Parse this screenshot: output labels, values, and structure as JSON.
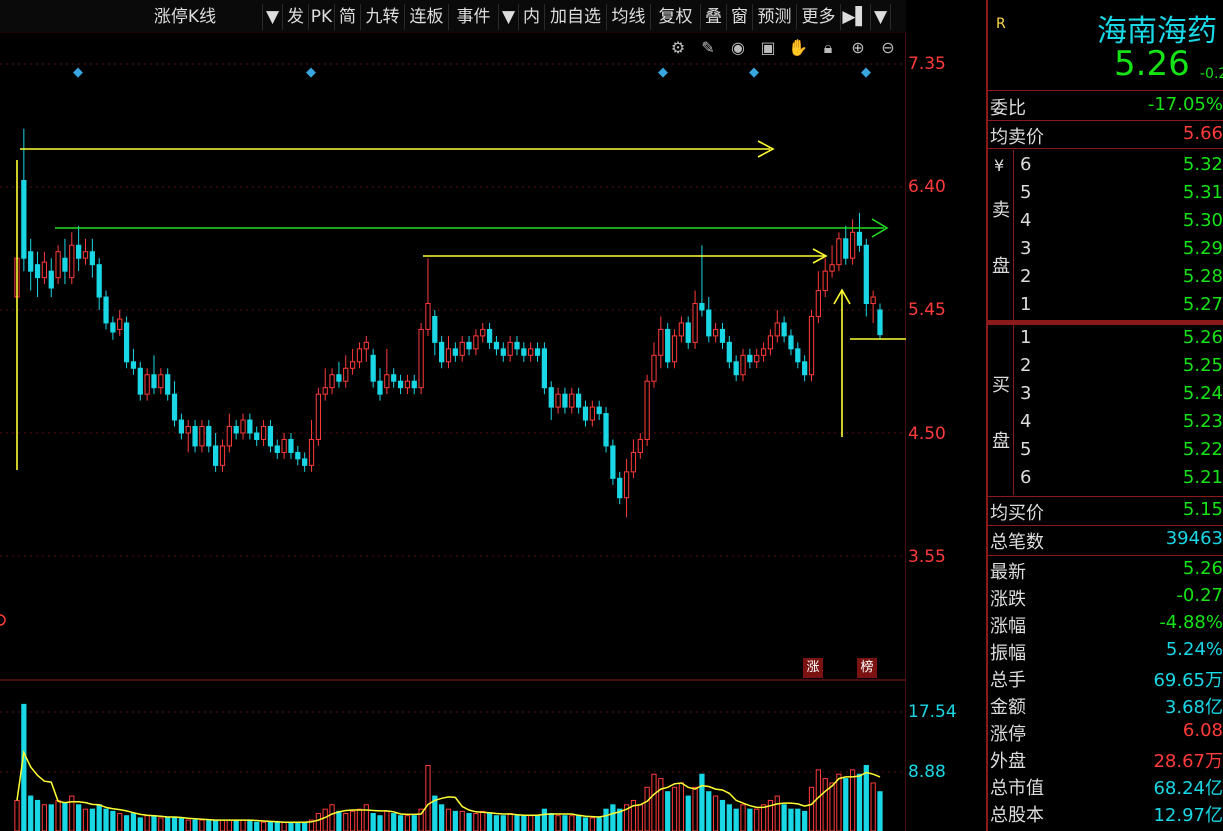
{
  "toolbar": {
    "items": [
      "涨停K线",
      "▼",
      "发",
      "PK",
      "简",
      "九转",
      "连板",
      "事件",
      "▼",
      "内",
      "加自选",
      "均线",
      "复权",
      "叠",
      "窗",
      "预测",
      "更多",
      "▶▌",
      "▼"
    ]
  },
  "chart_tools": [
    "gear-icon",
    "pen-icon",
    "eye-icon",
    "trash-icon",
    "hand-icon",
    "lock-icon",
    "zoom-in-icon",
    "zoom-out-icon"
  ],
  "chart_data": {
    "type": "candlestick",
    "price_axis": {
      "ticks": [
        "7.35",
        "6.40",
        "5.45",
        "4.50",
        "3.55"
      ],
      "ylim": [
        3.0,
        7.72
      ]
    },
    "volume_axis": {
      "ticks": [
        "17.54",
        "8.88"
      ]
    },
    "bottom_tags": [
      "涨",
      "榜"
    ],
    "candles": [
      [
        5.55,
        5.85,
        6.3,
        4.25
      ],
      [
        6.45,
        5.85,
        6.85,
        5.75
      ],
      [
        5.9,
        5.75,
        6.0,
        5.6
      ],
      [
        5.8,
        5.7,
        5.9,
        5.55
      ],
      [
        5.7,
        5.82,
        5.9,
        5.65
      ],
      [
        5.75,
        5.62,
        5.85,
        5.55
      ],
      [
        5.7,
        5.9,
        5.95,
        5.65
      ],
      [
        5.85,
        5.75,
        6.0,
        5.65
      ],
      [
        5.7,
        5.95,
        6.05,
        5.65
      ],
      [
        5.95,
        5.85,
        6.1,
        5.75
      ],
      [
        5.85,
        5.9,
        6.0,
        5.8
      ],
      [
        5.9,
        5.8,
        6.0,
        5.7
      ],
      [
        5.8,
        5.55,
        5.85,
        5.45
      ],
      [
        5.55,
        5.35,
        5.6,
        5.3
      ],
      [
        5.35,
        5.28,
        5.4,
        5.22
      ],
      [
        5.3,
        5.38,
        5.45,
        5.25
      ],
      [
        5.35,
        5.05,
        5.4,
        5.0
      ],
      [
        5.05,
        5.0,
        5.15,
        4.95
      ],
      [
        5.0,
        4.8,
        5.05,
        4.75
      ],
      [
        4.8,
        4.95,
        5.0,
        4.75
      ],
      [
        4.95,
        4.85,
        5.1,
        4.8
      ],
      [
        4.85,
        4.95,
        5.0,
        4.8
      ],
      [
        4.95,
        4.8,
        5.0,
        4.75
      ],
      [
        4.8,
        4.6,
        4.9,
        4.55
      ],
      [
        4.6,
        4.5,
        4.65,
        4.45
      ],
      [
        4.5,
        4.55,
        4.6,
        4.35
      ],
      [
        4.55,
        4.4,
        4.6,
        4.35
      ],
      [
        4.4,
        4.55,
        4.6,
        4.35
      ],
      [
        4.55,
        4.4,
        4.6,
        4.35
      ],
      [
        4.4,
        4.25,
        4.5,
        4.2
      ],
      [
        4.25,
        4.4,
        4.45,
        4.2
      ],
      [
        4.4,
        4.55,
        4.65,
        4.35
      ],
      [
        4.55,
        4.5,
        4.6,
        4.45
      ],
      [
        4.5,
        4.6,
        4.65,
        4.45
      ],
      [
        4.6,
        4.5,
        4.65,
        4.45
      ],
      [
        4.5,
        4.45,
        4.55,
        4.4
      ],
      [
        4.45,
        4.55,
        4.6,
        4.4
      ],
      [
        4.55,
        4.4,
        4.6,
        4.35
      ],
      [
        4.4,
        4.35,
        4.45,
        4.3
      ],
      [
        4.35,
        4.45,
        4.5,
        4.3
      ],
      [
        4.45,
        4.35,
        4.5,
        4.3
      ],
      [
        4.35,
        4.3,
        4.4,
        4.25
      ],
      [
        4.3,
        4.25,
        4.35,
        4.2
      ],
      [
        4.25,
        4.45,
        4.6,
        4.2
      ],
      [
        4.45,
        4.8,
        4.85,
        4.4
      ],
      [
        4.8,
        4.85,
        5.0,
        4.75
      ],
      [
        4.85,
        4.95,
        5.0,
        4.8
      ],
      [
        4.95,
        4.9,
        5.05,
        4.85
      ],
      [
        4.9,
        5.0,
        5.1,
        4.85
      ],
      [
        5.0,
        5.05,
        5.15,
        4.95
      ],
      [
        5.05,
        5.15,
        5.2,
        5.0
      ],
      [
        5.15,
        5.2,
        5.25,
        5.05
      ],
      [
        5.1,
        4.9,
        5.15,
        4.85
      ],
      [
        4.9,
        4.8,
        5.0,
        4.75
      ],
      [
        4.85,
        4.95,
        5.15,
        4.8
      ],
      [
        4.95,
        4.9,
        5.0,
        4.85
      ],
      [
        4.9,
        4.85,
        4.95,
        4.8
      ],
      [
        4.85,
        4.9,
        4.95,
        4.8
      ],
      [
        4.9,
        4.85,
        4.95,
        4.8
      ],
      [
        4.85,
        5.3,
        5.35,
        4.8
      ],
      [
        5.3,
        5.5,
        5.85,
        5.25
      ],
      [
        5.4,
        5.2,
        5.45,
        5.1
      ],
      [
        5.2,
        5.05,
        5.25,
        5.0
      ],
      [
        5.05,
        5.15,
        5.25,
        5.0
      ],
      [
        5.15,
        5.1,
        5.2,
        5.05
      ],
      [
        5.1,
        5.2,
        5.25,
        5.05
      ],
      [
        5.2,
        5.15,
        5.25,
        5.1
      ],
      [
        5.15,
        5.25,
        5.3,
        5.1
      ],
      [
        5.25,
        5.3,
        5.35,
        5.2
      ],
      [
        5.3,
        5.2,
        5.35,
        5.15
      ],
      [
        5.2,
        5.15,
        5.25,
        5.1
      ],
      [
        5.15,
        5.1,
        5.2,
        5.05
      ],
      [
        5.1,
        5.2,
        5.25,
        5.05
      ],
      [
        5.2,
        5.15,
        5.25,
        5.1
      ],
      [
        5.15,
        5.1,
        5.2,
        5.05
      ],
      [
        5.1,
        5.15,
        5.2,
        5.05
      ],
      [
        5.15,
        5.1,
        5.2,
        5.05
      ],
      [
        5.15,
        4.85,
        5.2,
        4.8
      ],
      [
        4.85,
        4.7,
        4.9,
        4.6
      ],
      [
        4.7,
        4.8,
        4.85,
        4.65
      ],
      [
        4.8,
        4.7,
        4.85,
        4.65
      ],
      [
        4.7,
        4.8,
        4.85,
        4.65
      ],
      [
        4.8,
        4.7,
        4.85,
        4.65
      ],
      [
        4.7,
        4.6,
        4.75,
        4.55
      ],
      [
        4.6,
        4.7,
        4.75,
        4.55
      ],
      [
        4.7,
        4.65,
        4.75,
        4.6
      ],
      [
        4.65,
        4.4,
        4.7,
        4.35
      ],
      [
        4.4,
        4.15,
        4.45,
        4.1
      ],
      [
        4.15,
        4.0,
        4.2,
        3.95
      ],
      [
        4.0,
        4.2,
        4.3,
        3.85
      ],
      [
        4.2,
        4.35,
        4.45,
        4.15
      ],
      [
        4.35,
        4.45,
        4.5,
        4.3
      ],
      [
        4.45,
        4.9,
        4.95,
        4.4
      ],
      [
        4.9,
        5.1,
        5.2,
        4.85
      ],
      [
        5.1,
        5.3,
        5.4,
        5.0
      ],
      [
        5.3,
        5.05,
        5.35,
        5.0
      ],
      [
        5.05,
        5.25,
        5.3,
        5.0
      ],
      [
        5.25,
        5.35,
        5.4,
        5.2
      ],
      [
        5.35,
        5.2,
        5.4,
        5.15
      ],
      [
        5.2,
        5.5,
        5.6,
        5.15
      ],
      [
        5.5,
        5.45,
        5.95,
        5.4
      ],
      [
        5.45,
        5.25,
        5.55,
        5.2
      ],
      [
        5.25,
        5.3,
        5.35,
        5.2
      ],
      [
        5.3,
        5.2,
        5.35,
        5.15
      ],
      [
        5.2,
        5.05,
        5.25,
        5.0
      ],
      [
        5.05,
        4.95,
        5.1,
        4.9
      ],
      [
        4.95,
        5.1,
        5.15,
        4.9
      ],
      [
        5.1,
        5.05,
        5.15,
        5.0
      ],
      [
        5.05,
        5.1,
        5.15,
        5.0
      ],
      [
        5.1,
        5.15,
        5.2,
        5.05
      ],
      [
        5.15,
        5.25,
        5.3,
        5.1
      ],
      [
        5.25,
        5.35,
        5.45,
        5.2
      ],
      [
        5.35,
        5.25,
        5.4,
        5.2
      ],
      [
        5.25,
        5.15,
        5.3,
        5.1
      ],
      [
        5.15,
        5.05,
        5.2,
        5.0
      ],
      [
        5.05,
        4.95,
        5.1,
        4.9
      ],
      [
        4.95,
        5.4,
        5.45,
        4.9
      ],
      [
        5.4,
        5.6,
        5.75,
        5.35
      ],
      [
        5.6,
        5.75,
        5.85,
        5.55
      ],
      [
        5.75,
        5.8,
        5.95,
        5.7
      ],
      [
        5.8,
        6.0,
        6.05,
        5.75
      ],
      [
        6.0,
        5.85,
        6.1,
        5.8
      ],
      [
        5.85,
        6.05,
        6.15,
        5.8
      ],
      [
        6.05,
        5.95,
        6.2,
        5.9
      ],
      [
        5.95,
        5.5,
        6.0,
        5.4
      ],
      [
        5.5,
        5.55,
        5.6,
        5.35
      ],
      [
        5.45,
        5.26,
        5.5,
        5.22
      ]
    ],
    "volumes": [
      14,
      58,
      16,
      14,
      12,
      12,
      14,
      13,
      16,
      12,
      10,
      10,
      12,
      10,
      9,
      8,
      7,
      8,
      6,
      7,
      7,
      6,
      6,
      6,
      6,
      5,
      5,
      5,
      5,
      5,
      5,
      5,
      5,
      5,
      5,
      4,
      4,
      4,
      4,
      4,
      4,
      4,
      4,
      5,
      8,
      10,
      12,
      9,
      8,
      9,
      10,
      12,
      8,
      7,
      9,
      8,
      7,
      7,
      7,
      10,
      30,
      16,
      12,
      10,
      9,
      9,
      8,
      8,
      9,
      8,
      7,
      7,
      8,
      7,
      7,
      7,
      7,
      10,
      8,
      7,
      7,
      7,
      7,
      6,
      6,
      6,
      10,
      12,
      10,
      12,
      14,
      12,
      20,
      26,
      24,
      18,
      20,
      22,
      16,
      20,
      26,
      18,
      16,
      14,
      12,
      10,
      12,
      10,
      10,
      12,
      14,
      16,
      12,
      10,
      10,
      9,
      20,
      28,
      24,
      22,
      26,
      24,
      28,
      26,
      30,
      22,
      18
    ],
    "volume_max": 60,
    "markers": [
      "◆",
      "◆",
      "◆",
      "◆",
      "◆"
    ]
  },
  "quote": {
    "flag": "R",
    "name": "海南海药",
    "price": "5.26",
    "change_small": "-0.2",
    "weibi_label": "委比",
    "weibi_value": "-17.05%",
    "avg_sell_label": "均卖价",
    "avg_sell_value": "5.66",
    "currency": "¥",
    "sell_label_1": "卖",
    "sell_label_2": "盘",
    "buy_label_1": "买",
    "buy_label_2": "盘",
    "sell_levels": [
      {
        "n": "6",
        "p": "5.32"
      },
      {
        "n": "5",
        "p": "5.31"
      },
      {
        "n": "4",
        "p": "5.30"
      },
      {
        "n": "3",
        "p": "5.29"
      },
      {
        "n": "2",
        "p": "5.28"
      },
      {
        "n": "1",
        "p": "5.27"
      }
    ],
    "buy_levels": [
      {
        "n": "1",
        "p": "5.26"
      },
      {
        "n": "2",
        "p": "5.25"
      },
      {
        "n": "3",
        "p": "5.24"
      },
      {
        "n": "4",
        "p": "5.23"
      },
      {
        "n": "5",
        "p": "5.22"
      },
      {
        "n": "6",
        "p": "5.21"
      }
    ],
    "avg_buy_label": "均买价",
    "avg_buy_value": "5.15",
    "total_trades_label": "总笔数",
    "total_trades_value": "39463",
    "stats": [
      {
        "label": "最新",
        "value": "5.26",
        "color": "g"
      },
      {
        "label": "涨跌",
        "value": "-0.27",
        "color": "g"
      },
      {
        "label": "涨幅",
        "value": "-4.88%",
        "color": "g"
      },
      {
        "label": "振幅",
        "value": "5.24%",
        "color": "c"
      },
      {
        "label": "总手",
        "value": "69.65万",
        "color": "c"
      },
      {
        "label": "金额",
        "value": "3.68亿",
        "color": "c"
      },
      {
        "label": "涨停",
        "value": "6.08",
        "color": "rd"
      },
      {
        "label": "外盘",
        "value": "28.67万",
        "color": "rd"
      },
      {
        "label": "总市值",
        "value": "68.24亿",
        "color": "c"
      },
      {
        "label": "总股本",
        "value": "12.97亿",
        "color": "c"
      }
    ]
  },
  "colors": {
    "up": "#ff3b3b",
    "down": "#19d7e5",
    "ma": "#ffff33",
    "panel_border": "#8b1a1a"
  }
}
